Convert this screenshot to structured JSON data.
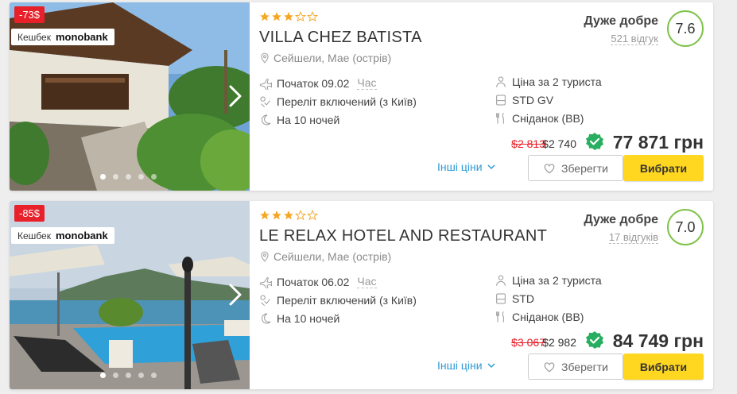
{
  "colors": {
    "accent_yellow": "#ffd620",
    "discount_red": "#e8202a",
    "rating_green": "#7fc24a",
    "link_blue": "#2d9ad6",
    "star": "#f5a623"
  },
  "hotels": [
    {
      "discount": "-73$",
      "cashback_label": "Кешбек",
      "cashback_brand": "monobank",
      "stars": 3,
      "stars_total": 5,
      "name": "VILLA CHEZ BATISTA",
      "location": "Сейшели, Мае (острів)",
      "start_label": "Початок 09.02",
      "time_link": "Час",
      "flight": "Переліт включений (з Київ)",
      "nights": "На 10 ночей",
      "price_for": "Ціна за 2 туриста",
      "room": "STD GV",
      "meal": "Сніданок (BB)",
      "rating_label": "Дуже добре",
      "reviews": "521 відгук",
      "score": "7.6",
      "old_price": "$2 813",
      "usd_price": "$2 740",
      "uah_price": "77 871 грн",
      "other_prices": "Інші ціни",
      "save_label": "Зберегти",
      "select_label": "Вибрати",
      "photo_dots": 5,
      "photo_active": 1
    },
    {
      "discount": "-85$",
      "cashback_label": "Кешбек",
      "cashback_brand": "monobank",
      "stars": 3,
      "stars_total": 5,
      "name": "LE RELAX HOTEL AND RESTAURANT",
      "location": "Сейшели, Мае (острів)",
      "start_label": "Початок 06.02",
      "time_link": "Час",
      "flight": "Переліт включений (з Київ)",
      "nights": "На 10 ночей",
      "price_for": "Ціна за 2 туриста",
      "room": "STD",
      "meal": "Сніданок (BB)",
      "rating_label": "Дуже добре",
      "reviews": "17 відгуків",
      "score": "7.0",
      "old_price": "$3 067",
      "usd_price": "$2 982",
      "uah_price": "84 749 грн",
      "other_prices": "Інші ціни",
      "save_label": "Зберегти",
      "select_label": "Вибрати",
      "photo_dots": 5,
      "photo_active": 1
    }
  ]
}
